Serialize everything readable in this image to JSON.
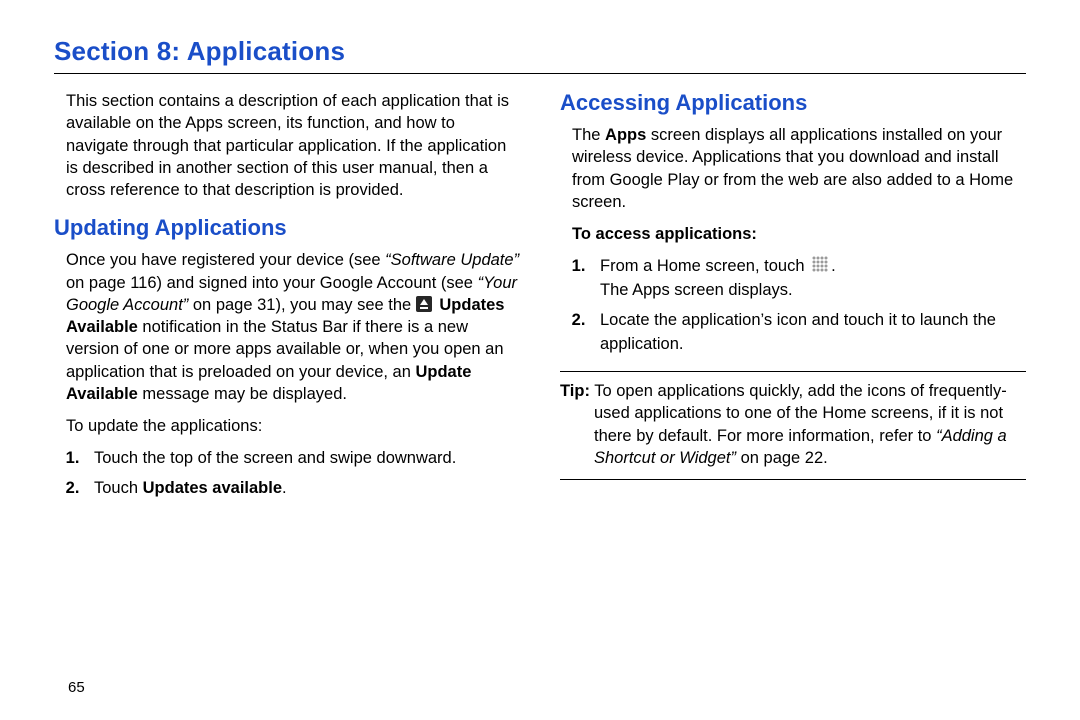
{
  "page_number": "65",
  "section_title": "Section 8: Applications",
  "left": {
    "intro": "This section contains a description of each application that is available on the Apps screen, its function, and how to navigate through that particular application. If the application is described in another section of this user manual, then a cross reference to that description is provided.",
    "updating_heading": "Updating Applications",
    "updating_p1_a": "Once you have registered your device (see ",
    "updating_p1_ref1": "“Software Update”",
    "updating_p1_b": " on page 116) and signed into your Google Account (see ",
    "updating_p1_ref2": "“Your Google Account”",
    "updating_p1_c": " on page 31), you may see the ",
    "updates_avail_bold": "Updates Available",
    "updating_p1_d": " notification in the Status Bar if there is a new version of one or more apps available or, when you open an application that is preloaded on your device, an ",
    "update_avail_bold": "Update Available",
    "updating_p1_e": " message may be displayed.",
    "to_update_label": "To update the applications:",
    "steps": [
      "Touch the top of the screen and swipe downward.",
      "Touch Updates available."
    ],
    "step2_prefix": "Touch ",
    "step2_bold": "Updates available",
    "step2_suffix": "."
  },
  "right": {
    "accessing_heading": "Accessing Applications",
    "accessing_intro_a": "The ",
    "accessing_intro_bold": "Apps",
    "accessing_intro_b": " screen displays all applications installed on your wireless device. Applications that you download and install from Google Play or from the web are also added to a Home screen.",
    "to_access_label": "To access applications:",
    "step1_a": "From a Home screen, touch ",
    "step1_b": ".",
    "step1_c": "The Apps screen displays.",
    "step2": "Locate the application’s icon and touch it to launch the application.",
    "tip_label": "Tip:",
    "tip_a": " To open applications quickly, add the icons of frequently-used applications to one of the Home screens, if it is not there by default. For more information, refer to ",
    "tip_ref": "“Adding a Shortcut or Widget”",
    "tip_b": " on page 22."
  }
}
